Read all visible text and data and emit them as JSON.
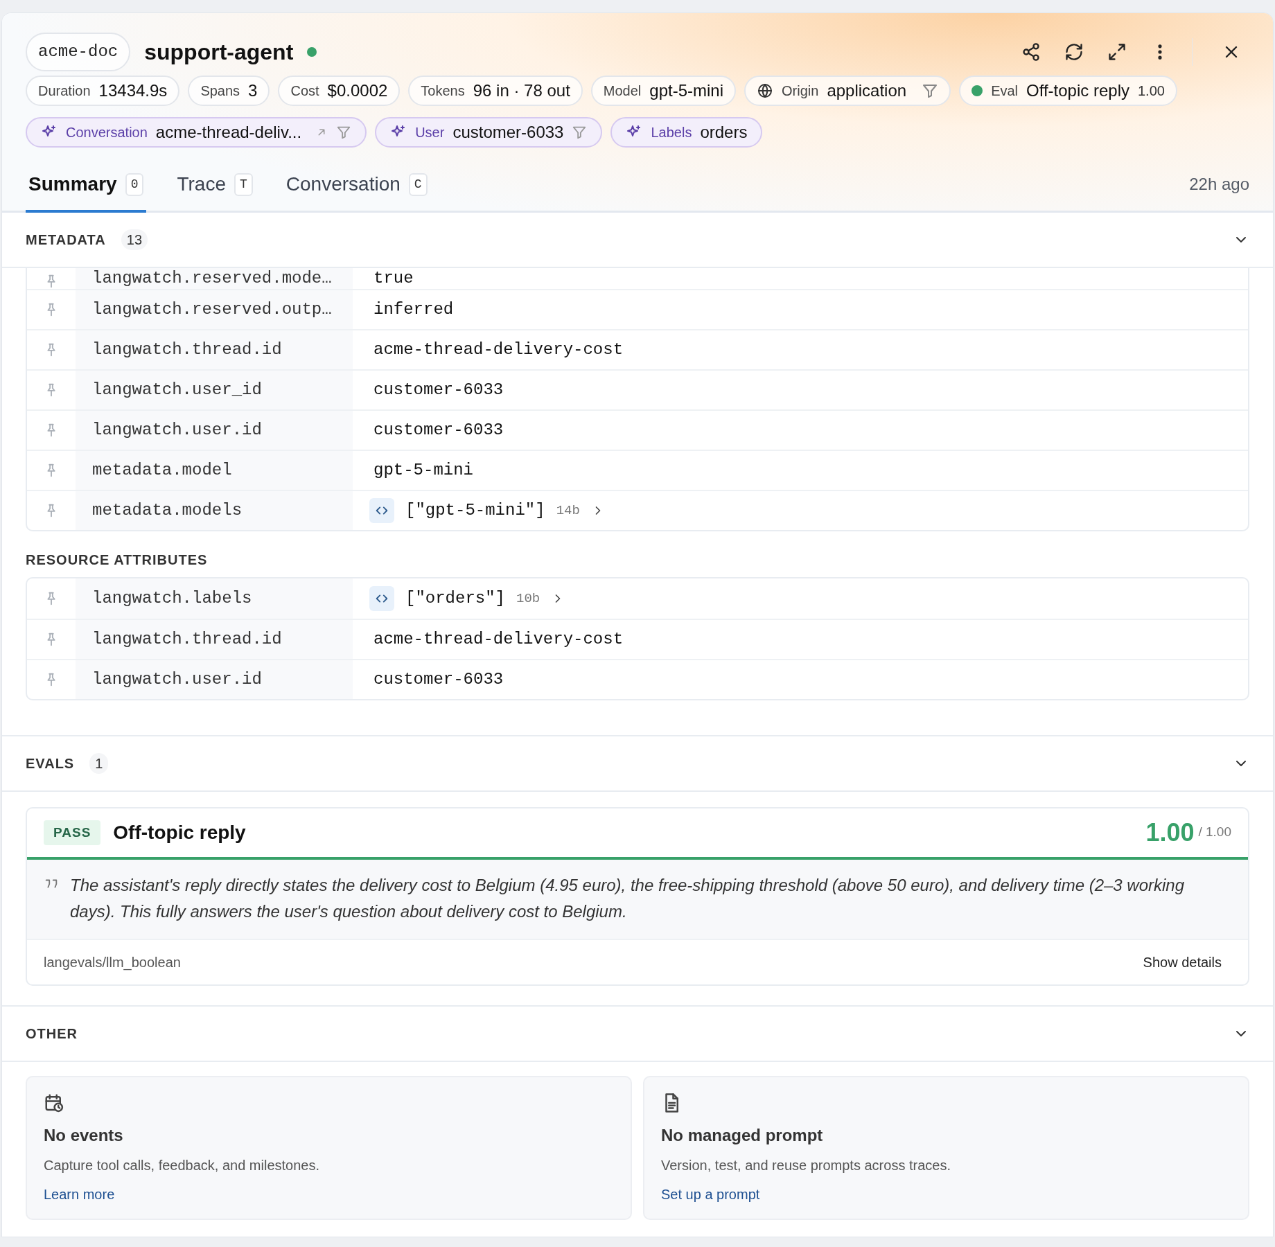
{
  "header": {
    "project": "acme-doc",
    "title": "support-agent",
    "live": true
  },
  "stats": [
    {
      "kind": "stat",
      "label": "Duration",
      "value": "13434.9s"
    },
    {
      "kind": "stat",
      "label": "Spans",
      "value": "3"
    },
    {
      "kind": "stat",
      "label": "Cost",
      "value": "$0.0002"
    },
    {
      "kind": "stat",
      "label": "Tokens",
      "value": "96 in · 78 out"
    },
    {
      "kind": "stat",
      "label": "Model",
      "value": "gpt-5-mini"
    },
    {
      "kind": "origin",
      "label": "Origin",
      "value": "application"
    },
    {
      "kind": "eval",
      "label": "Eval",
      "value": "Off-topic reply",
      "score": "1.00",
      "color": "#38a169"
    }
  ],
  "attributes": [
    {
      "label": "Conversation",
      "value": "acme-thread-deliv...",
      "link": true,
      "filter": true
    },
    {
      "label": "User",
      "value": "customer-6033",
      "link": false,
      "filter": true
    },
    {
      "label": "Labels",
      "value": "orders",
      "link": false,
      "filter": false
    }
  ],
  "tabs": [
    {
      "label": "Summary",
      "shortcut": "0",
      "selected": true
    },
    {
      "label": "Trace",
      "shortcut": "T",
      "selected": false
    },
    {
      "label": "Conversation",
      "shortcut": "C",
      "selected": false
    }
  ],
  "time": "22h ago",
  "metadata": {
    "title": "METADATA",
    "count": "13",
    "expanded": true,
    "rows": [
      {
        "kind": "text",
        "key": "langwatch.reserved.mode…",
        "value": "true"
      },
      {
        "kind": "text",
        "key": "langwatch.reserved.outp…",
        "value": "inferred"
      },
      {
        "kind": "text",
        "key": "langwatch.thread.id",
        "value": "acme-thread-delivery-cost"
      },
      {
        "kind": "text",
        "key": "langwatch.user_id",
        "value": "customer-6033"
      },
      {
        "kind": "text",
        "key": "langwatch.user.id",
        "value": "customer-6033"
      },
      {
        "kind": "text",
        "key": "metadata.model",
        "value": "gpt-5-mini"
      },
      {
        "kind": "json",
        "key": "metadata.models",
        "value": "[\"gpt-5-mini\"]",
        "size": "14b"
      }
    ]
  },
  "resource_attributes": {
    "title": "RESOURCE ATTRIBUTES",
    "rows": [
      {
        "kind": "json",
        "key": "langwatch.labels",
        "value": "[\"orders\"]",
        "size": "10b"
      },
      {
        "kind": "text",
        "key": "langwatch.thread.id",
        "value": "acme-thread-delivery-cost"
      },
      {
        "kind": "text",
        "key": "langwatch.user.id",
        "value": "customer-6033"
      }
    ]
  },
  "evals": {
    "title": "EVALS",
    "count": "1",
    "expanded": true,
    "items": [
      {
        "status": "PASS",
        "passed": true,
        "name": "Off-topic reply",
        "score": "1.00",
        "max": "/ 1.00",
        "reasoning": "The assistant's reply directly states the delivery cost to Belgium (4.95 euro), the free-shipping threshold (above 50 euro), and delivery time (2–3 working days). This fully answers the user's question about delivery cost to Belgium.",
        "evaluator": "langevals/llm_boolean",
        "action": "Show details"
      }
    ]
  },
  "other": {
    "title": "OTHER",
    "expanded": true,
    "cards": [
      {
        "kind": "events",
        "title": "No events",
        "text": "Capture tool calls, feedback, and milestones.",
        "link": "Learn more"
      },
      {
        "kind": "prompt",
        "title": "No managed prompt",
        "text": "Version, test, and reuse prompts across traces.",
        "link": "Set up a prompt"
      }
    ]
  }
}
